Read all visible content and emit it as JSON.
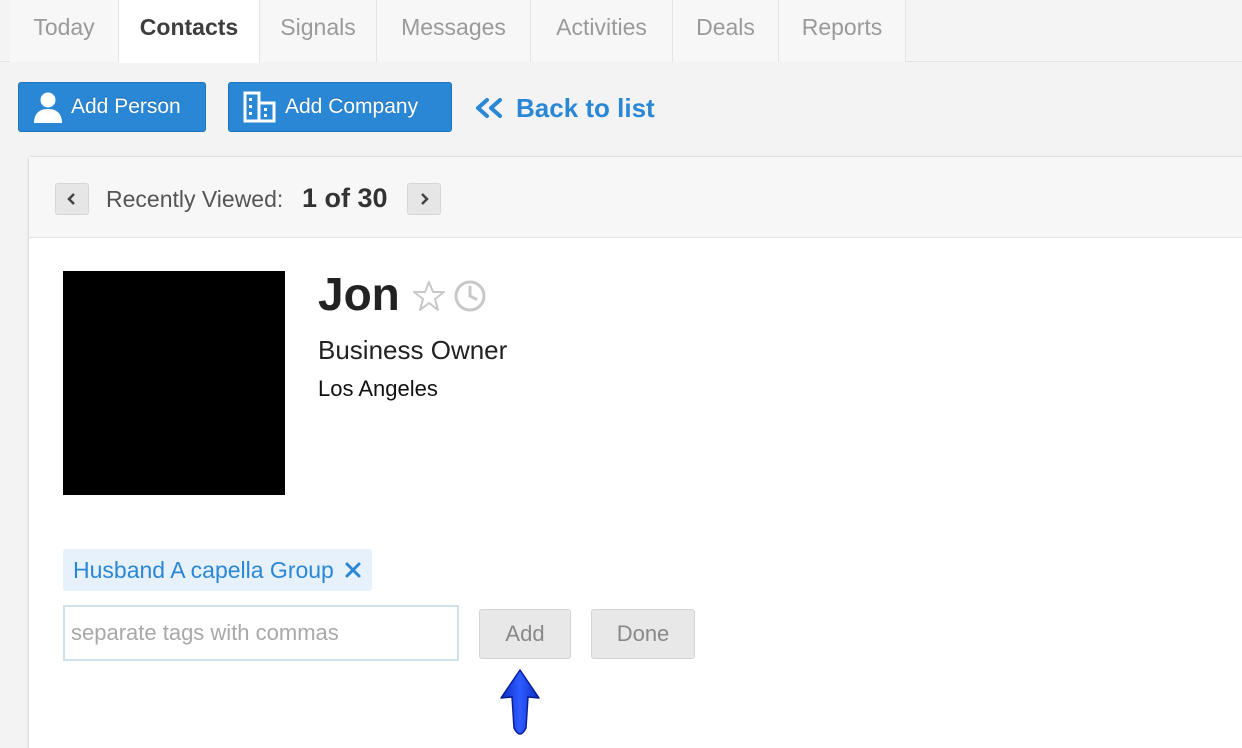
{
  "tabs": [
    {
      "label": "Today"
    },
    {
      "label": "Contacts"
    },
    {
      "label": "Signals"
    },
    {
      "label": "Messages"
    },
    {
      "label": "Activities"
    },
    {
      "label": "Deals"
    },
    {
      "label": "Reports"
    }
  ],
  "active_tab": "Contacts",
  "toolbar": {
    "add_person_label": "Add Person",
    "add_company_label": "Add Company",
    "back_label": "Back to list"
  },
  "recently_viewed": {
    "label": "Recently Viewed:",
    "count": "1 of 30"
  },
  "contact": {
    "name": "Jon",
    "title": "Business Owner",
    "location": "Los Angeles"
  },
  "tags": {
    "items": [
      {
        "label": "Husband A capella Group"
      }
    ],
    "input_placeholder": "separate tags with commas",
    "input_value": "",
    "add_label": "Add",
    "done_label": "Done"
  },
  "icons": {
    "person": "person-icon",
    "company": "building-icon",
    "back": "double-chevron-left-icon",
    "prev": "chevron-left-icon",
    "next": "chevron-right-icon",
    "star": "star-icon",
    "clock": "clock-icon",
    "remove_tag": "close-icon",
    "annotation": "arrow-up-icon"
  },
  "colors": {
    "accent": "#2a87d5",
    "annotation_arrow": "#1a3fe0"
  }
}
